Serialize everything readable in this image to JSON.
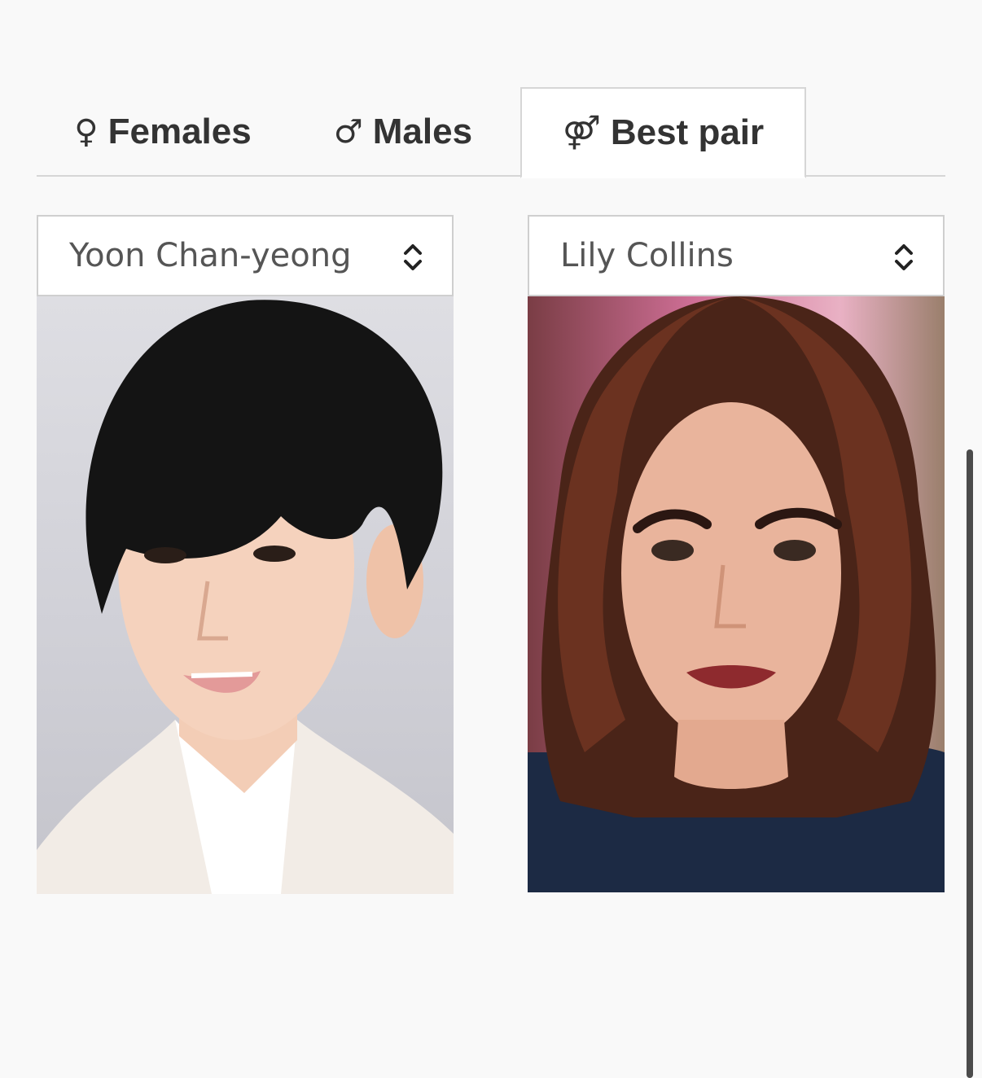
{
  "tabs": [
    {
      "symbol": "♀",
      "label": "Females",
      "icon": "female-symbol-icon"
    },
    {
      "symbol": "♂",
      "label": "Males",
      "icon": "male-symbol-icon"
    },
    {
      "symbol": "⚤",
      "label": "Best pair",
      "icon": "couple-symbol-icon",
      "active": true
    }
  ],
  "left_select": {
    "value": "Yoon Chan-yeong"
  },
  "right_select": {
    "value": "Lily Collins"
  },
  "colors": {
    "background": "#f9f9f9",
    "tab_text": "#333333",
    "select_text": "#555555",
    "border": "#d6d6d6"
  }
}
